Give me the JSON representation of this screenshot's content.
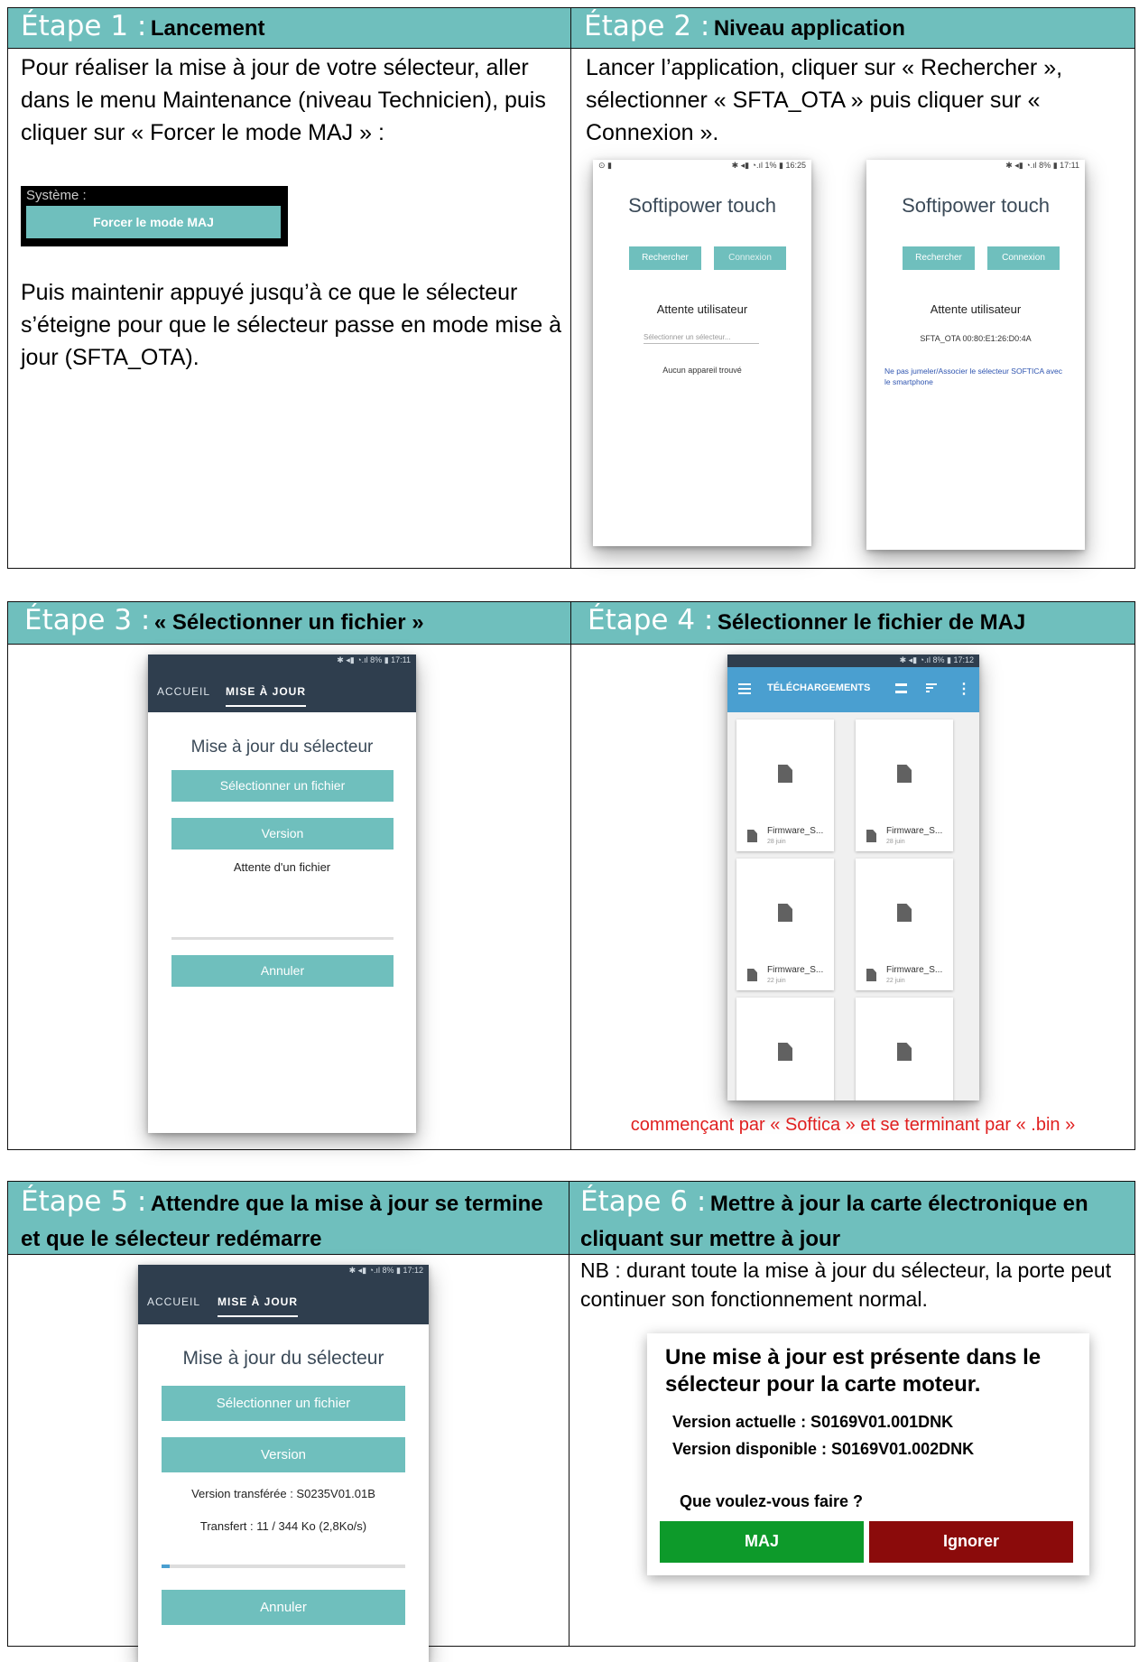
{
  "step1": {
    "number": "Étape 1 :",
    "title": "Lancement",
    "text": "Pour réaliser la mise à jour de votre sélecteur, aller dans le menu Maintenance (niveau Technicien), puis cliquer sur « Forcer le mode MAJ » :",
    "widget_label": "Système :",
    "widget_button": "Forcer le mode MAJ",
    "text2": "Puis maintenir appuyé jusqu’à ce que le sélecteur s’éteigne pour que le sélecteur passe en mode mise à jour (SFTA_OTA)."
  },
  "step2": {
    "number": "Étape 2 :",
    "title": "Niveau application",
    "text": "Lancer l’application, cliquer sur « Rechercher », sélectionner « SFTA_OTA » puis cliquer sur « Connexion ».",
    "phone_a": {
      "status": "✱ ◂▮ ◔.ıl 1% ▮ 16:25",
      "status_left": "⊙ ▮",
      "app_title": "Softipower touch",
      "btn1": "Rechercher",
      "btn2": "Connexion",
      "waiting": "Attente utilisateur",
      "select_placeholder": "Sélectionner un sélecteur...",
      "message": "Aucun appareil trouvé"
    },
    "phone_b": {
      "status": "✱ ◂▮ ◔.ıl 8% ▮ 17:11",
      "app_title": "Softipower touch",
      "btn1": "Rechercher",
      "btn2": "Connexion",
      "waiting": "Attente utilisateur",
      "device": "SFTA_OTA 00:80:E1:26:D0:4A",
      "message": "Ne pas jumeler/Associer le sélecteur SOFTICA avec le smartphone"
    }
  },
  "step3": {
    "number": "Étape 3 :",
    "title": "« Sélectionner un fichier »",
    "phone": {
      "status": "✱ ◂▮ ◔.ıl 8% ▮ 17:11",
      "tab1": "ACCUEIL",
      "tab2": "MISE À JOUR",
      "heading": "Mise à jour du sélecteur",
      "btn_select": "Sélectionner un fichier",
      "btn_version": "Version",
      "waiting": "Attente d'un fichier",
      "btn_cancel": "Annuler"
    }
  },
  "step4": {
    "number": "Étape 4 :",
    "title": "Sélectionner le fichier de MAJ",
    "phone": {
      "status": "✱ ◂▮ ◔.ıl 8% ▮ 17:12",
      "toolbar_title": "TÉLÉCHARGEMENTS",
      "files": [
        {
          "name": "Firmware_S...",
          "date": "28 juin"
        },
        {
          "name": "Firmware_S...",
          "date": "28 juin"
        },
        {
          "name": "Firmware_S...",
          "date": "22 juin"
        },
        {
          "name": "Firmware_S...",
          "date": "22 juin"
        }
      ]
    },
    "note": "commençant par « Softica » et se terminant par « .bin »",
    "note_color": "#e02020"
  },
  "step5": {
    "number": "Étape 5 :",
    "title": "Attendre que la mise à jour se termine et que le sélecteur redémarre",
    "phone": {
      "status": "✱ ◂▮ ◔.ıl 8% ▮ 17:12",
      "tab1": "ACCUEIL",
      "tab2": "MISE À JOUR",
      "heading": "Mise à jour du sélecteur",
      "btn_select": "Sélectionner un fichier",
      "btn_version": "Version",
      "transferred": "Version transférée : S0235V01.01B",
      "transfer": "Transfert : 11 / 344 Ko (2,8Ko/s)",
      "progress": 0.032,
      "btn_cancel": "Annuler"
    }
  },
  "step6": {
    "number": "Étape 6 :",
    "title": "Mettre à jour la carte électronique en cliquant sur mettre à jour",
    "text": "NB : durant toute la mise à jour du sélecteur, la porte peut continuer son fonctionnement normal.",
    "dialog": {
      "title": "Une mise à jour est présente dans le sélecteur pour la carte moteur.",
      "current": "Version actuelle : S0169V01.001DNK",
      "available": "Version disponible : S0169V01.002DNK",
      "question": "Que voulez-vous faire ?",
      "btn_maj": "MAJ",
      "btn_ignore": "Ignorer"
    }
  },
  "colors": {
    "teal": "#6fbfbd",
    "dark": "#2f3e4e",
    "green": "#0d9a2a",
    "red": "#8b0b0b"
  }
}
